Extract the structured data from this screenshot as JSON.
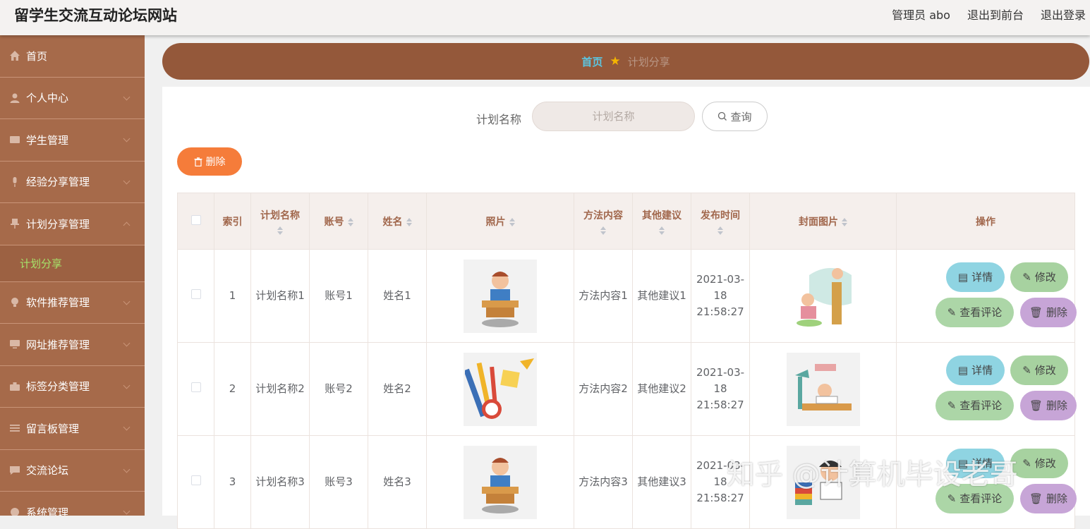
{
  "header": {
    "site_title": "留学生交流互动论坛网站",
    "admin_label": "管理员 abo",
    "to_front": "退出到前台",
    "logout": "退出登录"
  },
  "sidebar": {
    "items": [
      {
        "label": "首页",
        "icon": "home-icon"
      },
      {
        "label": "个人中心",
        "icon": "user-icon"
      },
      {
        "label": "学生管理",
        "icon": "id-card-icon"
      },
      {
        "label": "经验分享管理",
        "icon": "mic-icon"
      },
      {
        "label": "计划分享管理",
        "icon": "pin-icon"
      },
      {
        "label": "软件推荐管理",
        "icon": "bulb-icon"
      },
      {
        "label": "网址推荐管理",
        "icon": "monitor-icon"
      },
      {
        "label": "标签分类管理",
        "icon": "briefcase-icon"
      },
      {
        "label": "留言板管理",
        "icon": "list-icon"
      },
      {
        "label": "交流论坛",
        "icon": "chat-icon"
      },
      {
        "label": "系统管理",
        "icon": "settings-icon"
      }
    ],
    "sub_item": "计划分享"
  },
  "breadcrumb": {
    "home": "首页",
    "current": "计划分享"
  },
  "search": {
    "label": "计划名称",
    "placeholder": "计划名称",
    "button": "查询"
  },
  "toolbar": {
    "delete_label": "删除"
  },
  "table": {
    "headers": {
      "index": "索引",
      "plan_name": "计划名称",
      "account": "账号",
      "name": "姓名",
      "photo": "照片",
      "method": "方法内容",
      "advice": "其他建议",
      "time": "发布时间",
      "cover": "封面图片",
      "ops": "操作"
    },
    "rows": [
      {
        "index": "1",
        "plan_name": "计划名称1",
        "account": "账号1",
        "name": "姓名1",
        "method": "方法内容1",
        "advice": "其他建议1",
        "time": "2021-03-18 21:58:27"
      },
      {
        "index": "2",
        "plan_name": "计划名称2",
        "account": "账号2",
        "name": "姓名2",
        "method": "方法内容2",
        "advice": "其他建议2",
        "time": "2021-03-18 21:58:27"
      },
      {
        "index": "3",
        "plan_name": "计划名称3",
        "account": "账号3",
        "name": "姓名3",
        "method": "方法内容3",
        "advice": "其他建议3",
        "time": "2021-03-18 21:58:27"
      }
    ],
    "actions": {
      "detail": "详情",
      "edit": "修改",
      "comment": "查看评论",
      "delete": "删除"
    }
  },
  "watermark": "知乎 @计算机毕设老哥",
  "colors": {
    "sidebar": "#a66a4a",
    "breadcrumb_bar": "#94583a",
    "accent_green": "#a6e36a",
    "delete_orange": "#f57c3a"
  }
}
